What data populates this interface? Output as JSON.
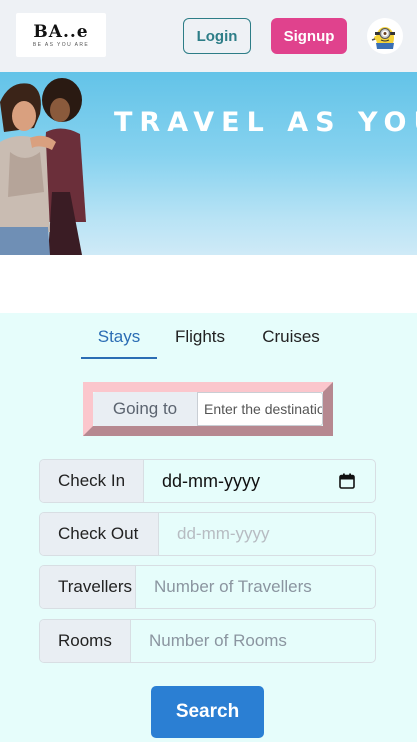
{
  "header": {
    "logo": {
      "main": "BA..e",
      "tagline": "BE AS YOU ARE"
    },
    "login_label": "Login",
    "signup_label": "Signup",
    "avatar_icon": "minion-avatar-icon"
  },
  "hero": {
    "tagline": "TRAVEL AS YOU A"
  },
  "search": {
    "tabs": [
      {
        "label": "Stays",
        "active": true
      },
      {
        "label": "Flights",
        "active": false
      },
      {
        "label": "Cruises",
        "active": false
      }
    ],
    "going_to": {
      "label": "Going to",
      "placeholder": "Enter the destination"
    },
    "check_in": {
      "label": "Check In",
      "value": "dd-mm-yyyy"
    },
    "check_out": {
      "label": "Check Out",
      "placeholder": "dd-mm-yyyy"
    },
    "travellers": {
      "label": "Travellers",
      "placeholder": "Number of Travellers"
    },
    "rooms": {
      "label": "Rooms",
      "placeholder": "Number of Rooms"
    },
    "search_label": "Search"
  },
  "colors": {
    "header_bg": "#eef1f5",
    "signup": "#e0428d",
    "login_border": "#2d7d87",
    "search_area_bg": "#e6fdfb",
    "accent": "#2b7fd3",
    "tab_active": "#2b6db4"
  }
}
